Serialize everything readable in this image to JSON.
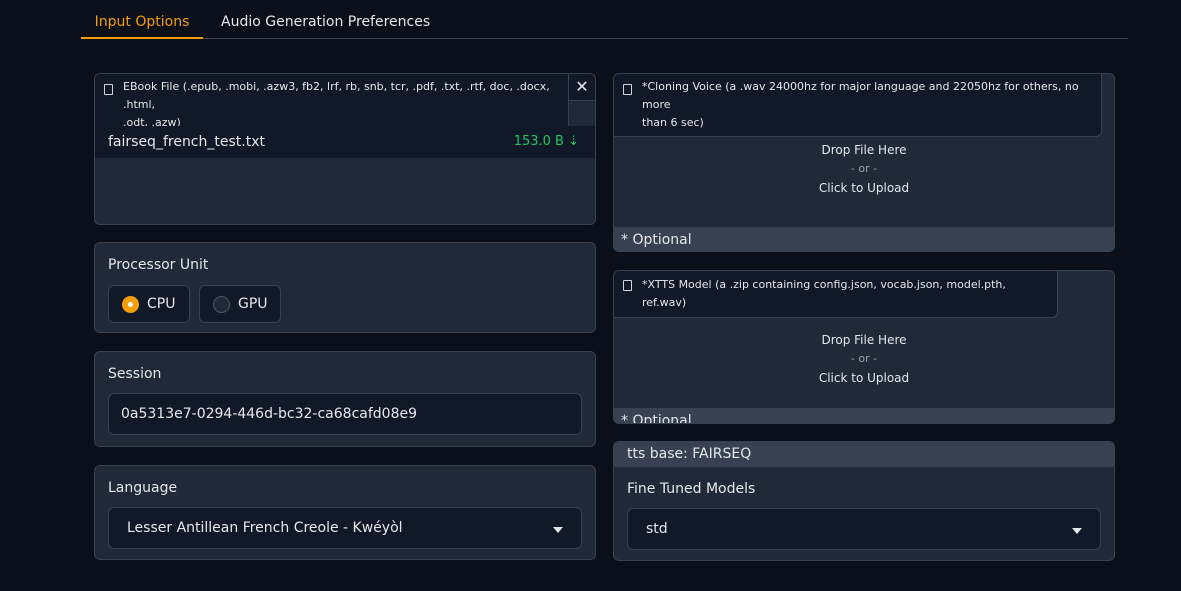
{
  "tabs": [
    {
      "label": "Input Options"
    },
    {
      "label": "Audio Generation Preferences"
    }
  ],
  "ebook": {
    "label_line1": "EBook File (.epub, .mobi, .azw3, fb2, lrf, rb, snb, tcr, .pdf, .txt, .rtf, doc, .docx, .html,",
    "label_line2": ".odt, .azw)",
    "close": "✕",
    "file_name": "fairseq_french_test.txt",
    "file_size": "153.0 B ⇣"
  },
  "processor": {
    "title": "Processor Unit",
    "options": [
      {
        "label": "CPU",
        "selected": true
      },
      {
        "label": "GPU",
        "selected": false
      }
    ]
  },
  "session": {
    "title": "Session",
    "value": "0a5313e7-0294-446d-bc32-ca68cafd08e9"
  },
  "language": {
    "title": "Language",
    "value": "Lesser Antillean French Creole - Kwéyòl"
  },
  "voice": {
    "label_line1": "*Cloning Voice (a .wav 24000hz for major language and 22050hz for others, no more",
    "label_line2": "than 6 sec)",
    "drop": "Drop File Here",
    "or": "- or -",
    "click": "Click to Upload",
    "optional": "* Optional"
  },
  "xtts": {
    "label": "*XTTS Model (a .zip containing config.json, vocab.json, model.pth, ref.wav)",
    "drop": "Drop File Here",
    "or": "- or -",
    "click": "Click to Upload",
    "optional": "* Optional"
  },
  "tts": {
    "base": "tts base: FAIRSEQ",
    "title": "Fine Tuned Models",
    "value": "std"
  },
  "colors": {
    "accent": "#f59e0b",
    "bg": "#0b0f19",
    "panel": "#1f2937",
    "size_green": "#22c55e"
  }
}
